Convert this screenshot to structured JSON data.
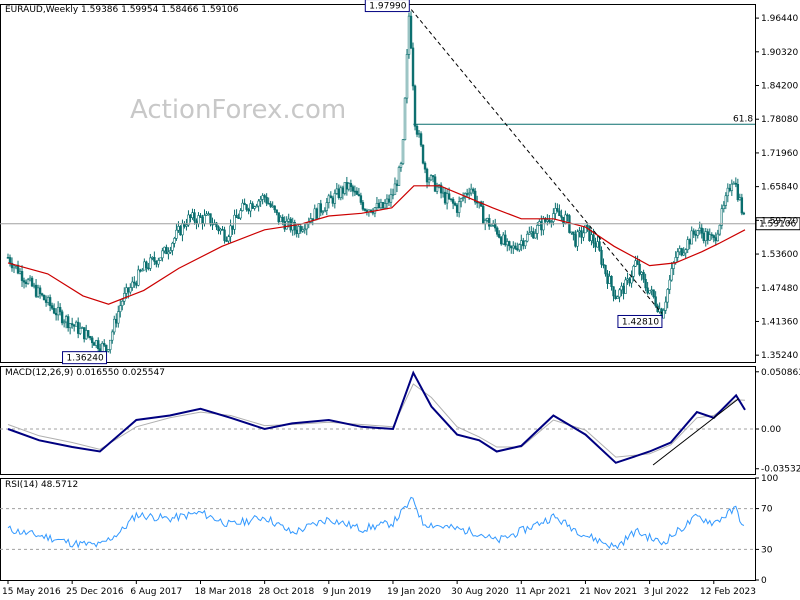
{
  "main_header": "EURAUD,Weekly  1.59386 1.59954 1.58466 1.59106",
  "watermark": "ActionForex.com",
  "colors": {
    "bars": "#0a6e6e",
    "ma": "#cc0000",
    "macd": "#000080",
    "signal": "#b0b0b0",
    "rsi": "#3399ff",
    "frame": "#000000"
  },
  "chart_data": [
    {
      "type": "candlestick",
      "title": "EURAUD,Weekly  1.59386 1.59954 1.58466 1.59106",
      "ylim": [
        1.34,
        1.99
      ],
      "y_ticks": [
        "1.96440",
        "1.90320",
        "1.84200",
        "1.78080",
        "1.71960",
        "1.65840",
        "1.59720",
        "1.53600",
        "1.47480",
        "1.41360",
        "1.35240"
      ],
      "last_price_label": "1.59106",
      "fib_label": "61.8",
      "fib_level": 1.7716,
      "annotations": [
        {
          "text": "1.97990",
          "date": "2020-03-16",
          "price": 1.9799
        },
        {
          "text": "1.36240",
          "date": "2017-04-24",
          "price": 1.3624
        },
        {
          "text": "1.42810",
          "date": "2022-08-15",
          "price": 1.4281
        }
      ],
      "price_path": [
        [
          "2016-05-15",
          1.53
        ],
        [
          "2016-08-01",
          1.48
        ],
        [
          "2016-11-01",
          1.43
        ],
        [
          "2017-01-15",
          1.4
        ],
        [
          "2017-04-24",
          1.3624
        ],
        [
          "2017-06-15",
          1.45
        ],
        [
          "2017-09-01",
          1.51
        ],
        [
          "2017-11-15",
          1.54
        ],
        [
          "2018-02-01",
          1.6
        ],
        [
          "2018-04-15",
          1.6
        ],
        [
          "2018-06-15",
          1.57
        ],
        [
          "2018-08-15",
          1.62
        ],
        [
          "2018-10-28",
          1.64
        ],
        [
          "2018-12-15",
          1.6
        ],
        [
          "2019-02-15",
          1.58
        ],
        [
          "2019-05-15",
          1.62
        ],
        [
          "2019-08-15",
          1.66
        ],
        [
          "2019-10-15",
          1.62
        ],
        [
          "2019-12-15",
          1.62
        ],
        [
          "2020-01-15",
          1.64
        ],
        [
          "2020-02-20",
          1.7
        ],
        [
          "2020-03-16",
          1.9799
        ],
        [
          "2020-04-05",
          1.78
        ],
        [
          "2020-05-15",
          1.68
        ],
        [
          "2020-07-15",
          1.64
        ],
        [
          "2020-08-30",
          1.62
        ],
        [
          "2020-10-15",
          1.66
        ],
        [
          "2020-12-01",
          1.6
        ],
        [
          "2021-01-15",
          1.58
        ],
        [
          "2021-03-01",
          1.54
        ],
        [
          "2021-04-11",
          1.56
        ],
        [
          "2021-06-01",
          1.58
        ],
        [
          "2021-08-01",
          1.61
        ],
        [
          "2021-09-15",
          1.6
        ],
        [
          "2021-10-15",
          1.56
        ],
        [
          "2021-11-21",
          1.58
        ],
        [
          "2022-01-01",
          1.55
        ],
        [
          "2022-02-01",
          1.5
        ],
        [
          "2022-03-07",
          1.46
        ],
        [
          "2022-04-15",
          1.48
        ],
        [
          "2022-05-15",
          1.52
        ],
        [
          "2022-06-15",
          1.48
        ],
        [
          "2022-07-03",
          1.47
        ],
        [
          "2022-08-15",
          1.4281
        ],
        [
          "2022-10-01",
          1.53
        ],
        [
          "2022-11-01",
          1.55
        ],
        [
          "2022-12-15",
          1.58
        ],
        [
          "2023-02-12",
          1.56
        ],
        [
          "2023-03-20",
          1.62
        ],
        [
          "2023-04-20",
          1.68
        ],
        [
          "2023-05-15",
          1.63
        ],
        [
          "2023-06-01",
          1.591
        ]
      ],
      "ma_path": [
        [
          "2016-05-15",
          1.52
        ],
        [
          "2016-10-01",
          1.5
        ],
        [
          "2017-02-01",
          1.46
        ],
        [
          "2017-05-01",
          1.445
        ],
        [
          "2017-09-01",
          1.47
        ],
        [
          "2018-01-01",
          1.51
        ],
        [
          "2018-06-01",
          1.55
        ],
        [
          "2018-10-28",
          1.58
        ],
        [
          "2019-03-01",
          1.59
        ],
        [
          "2019-06-09",
          1.605
        ],
        [
          "2019-10-01",
          1.61
        ],
        [
          "2020-01-15",
          1.62
        ],
        [
          "2020-04-01",
          1.66
        ],
        [
          "2020-07-01",
          1.66
        ],
        [
          "2020-10-01",
          1.64
        ],
        [
          "2021-01-01",
          1.62
        ],
        [
          "2021-04-11",
          1.6
        ],
        [
          "2021-08-01",
          1.6
        ],
        [
          "2021-11-21",
          1.585
        ],
        [
          "2022-03-01",
          1.55
        ],
        [
          "2022-07-03",
          1.515
        ],
        [
          "2022-10-01",
          1.52
        ],
        [
          "2023-01-01",
          1.54
        ],
        [
          "2023-03-01",
          1.555
        ],
        [
          "2023-06-01",
          1.58
        ]
      ],
      "trend_line": [
        [
          "2020-03-23",
          1.9799
        ],
        [
          "2022-08-15",
          1.4281
        ]
      ]
    },
    {
      "type": "line",
      "title": "MACD(12,26,9) 0.016550 0.025547",
      "ylim": [
        -0.04,
        0.056
      ],
      "y_ticks": [
        "0.050863",
        "0.00",
        "-0.035322"
      ],
      "series": [
        {
          "name": "MACD",
          "values": [
            [
              "2016-05-15",
              0.0
            ],
            [
              "2016-09-01",
              -0.01
            ],
            [
              "2016-12-25",
              -0.016
            ],
            [
              "2017-04-01",
              -0.02
            ],
            [
              "2017-08-06",
              0.008
            ],
            [
              "2017-12-01",
              0.012
            ],
            [
              "2018-03-18",
              0.018
            ],
            [
              "2018-07-01",
              0.01
            ],
            [
              "2018-10-28",
              0.0
            ],
            [
              "2019-02-01",
              0.005
            ],
            [
              "2019-06-09",
              0.008
            ],
            [
              "2019-10-01",
              0.002
            ],
            [
              "2020-01-19",
              0.0
            ],
            [
              "2020-03-30",
              0.05
            ],
            [
              "2020-06-01",
              0.02
            ],
            [
              "2020-08-30",
              -0.005
            ],
            [
              "2020-11-15",
              -0.01
            ],
            [
              "2021-01-15",
              -0.02
            ],
            [
              "2021-04-11",
              -0.015
            ],
            [
              "2021-08-01",
              0.012
            ],
            [
              "2021-11-21",
              -0.005
            ],
            [
              "2022-03-07",
              -0.03
            ],
            [
              "2022-07-03",
              -0.02
            ],
            [
              "2022-09-15",
              -0.012
            ],
            [
              "2022-12-15",
              0.015
            ],
            [
              "2023-02-12",
              0.01
            ],
            [
              "2023-05-01",
              0.03
            ],
            [
              "2023-06-01",
              0.017
            ]
          ]
        },
        {
          "name": "Signal",
          "values": [
            [
              "2016-05-15",
              0.004
            ],
            [
              "2016-09-01",
              -0.006
            ],
            [
              "2016-12-25",
              -0.012
            ],
            [
              "2017-04-01",
              -0.018
            ],
            [
              "2017-08-06",
              0.002
            ],
            [
              "2017-12-01",
              0.01
            ],
            [
              "2018-03-18",
              0.015
            ],
            [
              "2018-07-01",
              0.012
            ],
            [
              "2018-10-28",
              0.003
            ],
            [
              "2019-02-01",
              0.004
            ],
            [
              "2019-06-09",
              0.006
            ],
            [
              "2019-10-01",
              0.004
            ],
            [
              "2020-01-19",
              0.002
            ],
            [
              "2020-03-30",
              0.04
            ],
            [
              "2020-06-01",
              0.028
            ],
            [
              "2020-08-30",
              0.002
            ],
            [
              "2020-11-15",
              -0.007
            ],
            [
              "2021-01-15",
              -0.016
            ],
            [
              "2021-04-11",
              -0.016
            ],
            [
              "2021-08-01",
              0.008
            ],
            [
              "2021-11-21",
              -0.001
            ],
            [
              "2022-03-07",
              -0.025
            ],
            [
              "2022-07-03",
              -0.022
            ],
            [
              "2022-09-15",
              -0.014
            ],
            [
              "2022-12-15",
              0.01
            ],
            [
              "2023-02-12",
              0.012
            ],
            [
              "2023-05-01",
              0.026
            ],
            [
              "2023-06-01",
              0.025547
            ]
          ]
        }
      ],
      "trend_line": [
        [
          "2022-07-15",
          -0.032
        ],
        [
          "2023-05-10",
          0.027
        ]
      ]
    },
    {
      "type": "line",
      "title": "RSI(14) 48.5712",
      "ylim": [
        0,
        100
      ],
      "y_ticks": [
        "100",
        "70",
        "30",
        "0"
      ],
      "levels": [
        70,
        30
      ],
      "series": [
        {
          "name": "RSI",
          "values": [
            [
              "2016-05-15",
              50
            ],
            [
              "2016-07-15",
              46
            ],
            [
              "2016-10-01",
              42
            ],
            [
              "2016-12-25",
              36
            ],
            [
              "2017-04-01",
              34
            ],
            [
              "2017-06-15",
              48
            ],
            [
              "2017-08-06",
              64
            ],
            [
              "2017-12-01",
              60
            ],
            [
              "2018-03-18",
              66
            ],
            [
              "2018-07-01",
              54
            ],
            [
              "2018-10-28",
              62
            ],
            [
              "2019-02-01",
              46
            ],
            [
              "2019-06-09",
              60
            ],
            [
              "2019-10-01",
              50
            ],
            [
              "2020-01-19",
              56
            ],
            [
              "2020-03-30",
              80
            ],
            [
              "2020-05-01",
              56
            ],
            [
              "2020-08-30",
              50
            ],
            [
              "2020-11-15",
              46
            ],
            [
              "2021-01-15",
              38
            ],
            [
              "2021-04-11",
              48
            ],
            [
              "2021-08-01",
              62
            ],
            [
              "2021-11-21",
              44
            ],
            [
              "2022-03-07",
              32
            ],
            [
              "2022-05-15",
              48
            ],
            [
              "2022-08-15",
              36
            ],
            [
              "2022-12-15",
              62
            ],
            [
              "2023-02-12",
              56
            ],
            [
              "2023-05-01",
              70
            ],
            [
              "2023-06-01",
              48.5712
            ]
          ]
        }
      ]
    }
  ],
  "x_axis": {
    "labels": [
      "15 May 2016",
      "25 Dec 2016",
      "6 Aug 2017",
      "18 Mar 2018",
      "28 Oct 2018",
      "9 Jun 2019",
      "19 Jan 2020",
      "30 Aug 2020",
      "11 Apr 2021",
      "21 Nov 2021",
      "3 Jul 2022",
      "12 Feb 2023"
    ],
    "dates": [
      "2016-05-15",
      "2016-12-25",
      "2017-08-06",
      "2018-03-18",
      "2018-10-28",
      "2019-06-09",
      "2020-01-19",
      "2020-08-30",
      "2021-04-11",
      "2021-11-21",
      "2022-07-03",
      "2023-02-12"
    ]
  }
}
